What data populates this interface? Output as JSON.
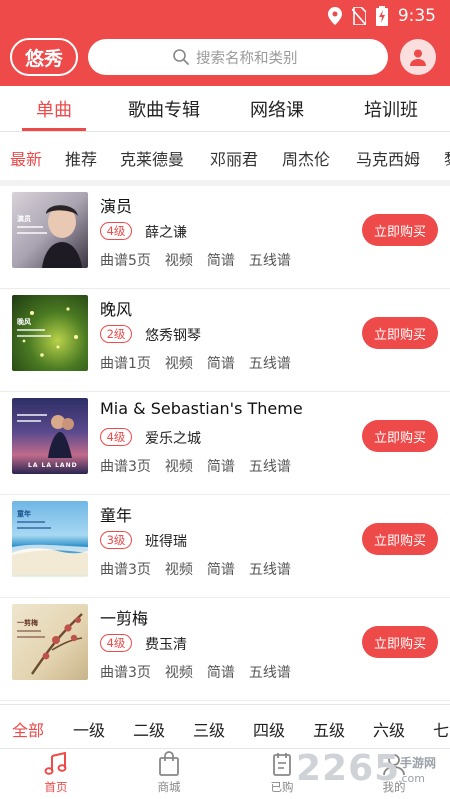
{
  "status_bar": {
    "time": "9:35"
  },
  "header": {
    "logo_text": "悠秀",
    "search_placeholder": "搜索名称和类别",
    "colors": {
      "primary": "#ee4a4a"
    }
  },
  "main_tabs": [
    {
      "label": "单曲",
      "active": true
    },
    {
      "label": "歌曲专辑",
      "active": false
    },
    {
      "label": "网络课",
      "active": false
    },
    {
      "label": "培训班",
      "active": false
    }
  ],
  "sub_tabs": [
    {
      "label": "最新",
      "active": true
    },
    {
      "label": "推荐",
      "active": false
    },
    {
      "label": "克莱德曼",
      "active": false
    },
    {
      "label": "邓丽君",
      "active": false
    },
    {
      "label": "周杰伦",
      "active": false
    },
    {
      "label": "马克西姆",
      "active": false
    },
    {
      "label": "黎",
      "active": false
    }
  ],
  "songs": [
    {
      "title": "演员",
      "level": "4级",
      "artist": "薛之谦",
      "pages": "曲谱5页",
      "tags": [
        "视频",
        "简谱",
        "五线谱"
      ],
      "buy_label": "立即购买"
    },
    {
      "title": "晚风",
      "level": "2级",
      "artist": "悠秀钢琴",
      "pages": "曲谱1页",
      "tags": [
        "视频",
        "简谱",
        "五线谱"
      ],
      "buy_label": "立即购买"
    },
    {
      "title": "Mia & Sebastian's Theme",
      "level": "4级",
      "artist": "爱乐之城",
      "pages": "曲谱3页",
      "tags": [
        "视频",
        "简谱",
        "五线谱"
      ],
      "buy_label": "立即购买"
    },
    {
      "title": "童年",
      "level": "3级",
      "artist": "班得瑞",
      "pages": "曲谱3页",
      "tags": [
        "视频",
        "简谱",
        "五线谱"
      ],
      "buy_label": "立即购买"
    },
    {
      "title": "一剪梅",
      "level": "4级",
      "artist": "费玉清",
      "pages": "曲谱3页",
      "tags": [
        "视频",
        "简谱",
        "五线谱"
      ],
      "buy_label": "立即购买"
    }
  ],
  "thumb_texts": {
    "song0": "演员",
    "song1": "晚风",
    "song2": "LA LA LAND",
    "song3": "童年",
    "song4": "一剪梅"
  },
  "level_filter": [
    {
      "label": "全部",
      "active": true
    },
    {
      "label": "一级",
      "active": false
    },
    {
      "label": "二级",
      "active": false
    },
    {
      "label": "三级",
      "active": false
    },
    {
      "label": "四级",
      "active": false
    },
    {
      "label": "五级",
      "active": false
    },
    {
      "label": "六级",
      "active": false
    },
    {
      "label": "七",
      "active": false
    }
  ],
  "bottom_nav": [
    {
      "label": "首页",
      "icon": "music-note-icon",
      "active": true
    },
    {
      "label": "商城",
      "icon": "shopping-bag-icon",
      "active": false
    },
    {
      "label": "已购",
      "icon": "clipboard-icon",
      "active": false
    },
    {
      "label": "我的",
      "icon": "person-icon",
      "active": false
    }
  ],
  "watermark": {
    "number": "2265",
    "text": "手游网",
    "domain": ".com"
  }
}
